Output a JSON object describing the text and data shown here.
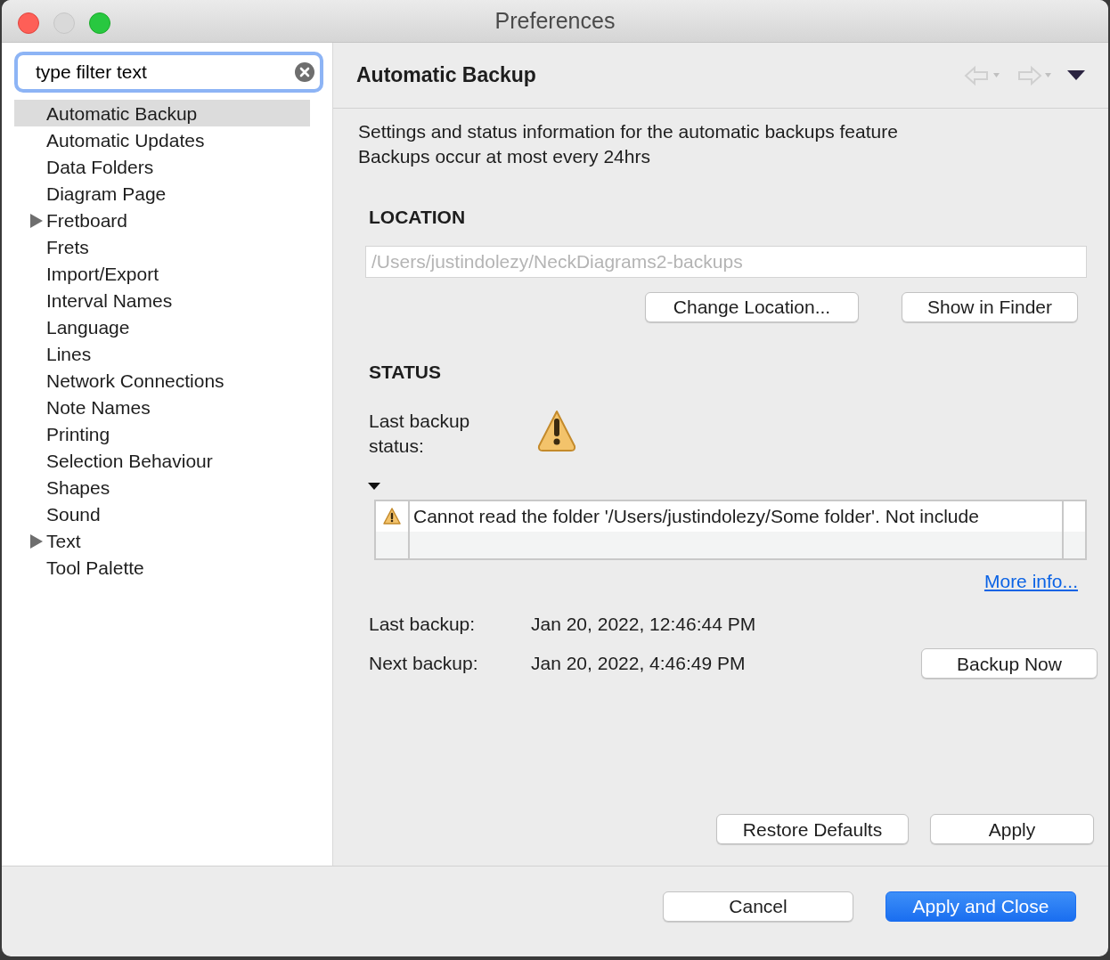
{
  "window": {
    "title": "Preferences"
  },
  "filter": {
    "value": "type filter text"
  },
  "tree": [
    {
      "label": "Automatic Backup",
      "selected": true,
      "expandable": false
    },
    {
      "label": "Automatic Updates",
      "selected": false,
      "expandable": false
    },
    {
      "label": "Data Folders",
      "selected": false,
      "expandable": false
    },
    {
      "label": "Diagram Page",
      "selected": false,
      "expandable": false
    },
    {
      "label": "Fretboard",
      "selected": false,
      "expandable": true
    },
    {
      "label": "Frets",
      "selected": false,
      "expandable": false
    },
    {
      "label": "Import/Export",
      "selected": false,
      "expandable": false
    },
    {
      "label": "Interval Names",
      "selected": false,
      "expandable": false
    },
    {
      "label": "Language",
      "selected": false,
      "expandable": false
    },
    {
      "label": "Lines",
      "selected": false,
      "expandable": false
    },
    {
      "label": "Network Connections",
      "selected": false,
      "expandable": false
    },
    {
      "label": "Note Names",
      "selected": false,
      "expandable": false
    },
    {
      "label": "Printing",
      "selected": false,
      "expandable": false
    },
    {
      "label": "Selection Behaviour",
      "selected": false,
      "expandable": false
    },
    {
      "label": "Shapes",
      "selected": false,
      "expandable": false
    },
    {
      "label": "Sound",
      "selected": false,
      "expandable": false
    },
    {
      "label": "Text",
      "selected": false,
      "expandable": true
    },
    {
      "label": "Tool Palette",
      "selected": false,
      "expandable": false
    }
  ],
  "page": {
    "title": "Automatic Backup",
    "description": [
      "Settings and status information for the automatic backups feature",
      "Backups occur at most every 24hrs"
    ],
    "location": {
      "heading": "LOCATION",
      "path": "/Users/justindolezy/NeckDiagrams2-backups",
      "disabled": true,
      "buttons": [
        "Change Location...",
        "Show in Finder"
      ]
    },
    "status": {
      "heading": "STATUS",
      "label": "Last backup status:",
      "expanded": true,
      "messages": [
        {
          "text": "Cannot read the folder '/Users/justindolezy/Some folder'. Not include"
        }
      ],
      "more_info": "More info...",
      "last_label": "Last backup:",
      "last_value": "Jan 20, 2022, 12:46:44 PM",
      "next_label": "Next backup:",
      "next_value": "Jan 20, 2022, 4:46:49 PM",
      "backup_button": "Backup Now"
    },
    "buttons": [
      "Restore Defaults",
      "Apply"
    ]
  },
  "footer": {
    "cancel": "Cancel",
    "ok": "Apply and Close"
  }
}
